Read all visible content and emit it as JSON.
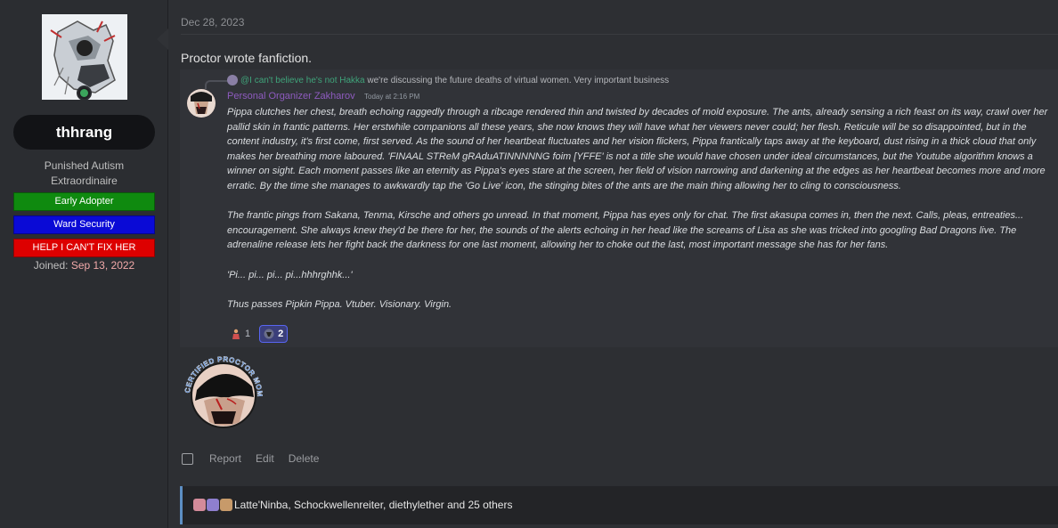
{
  "user": {
    "username": "thhrang",
    "title_line1": "Punished Autism",
    "title_line2": "Extraordinaire",
    "banners": [
      {
        "label": "Early Adopter",
        "color": "#0f8a0f"
      },
      {
        "label": "Ward Security",
        "color": "#0a0ad6"
      },
      {
        "label": "HELP I CAN'T FIX HER",
        "color": "#dd0000"
      }
    ],
    "joined_label": "Joined:",
    "joined_date": "Sep 13, 2022"
  },
  "post": {
    "date": "Dec 28, 2023",
    "text": "Proctor wrote fanfiction."
  },
  "embed": {
    "reply_mention": "@I can't believe he's not Hakka",
    "reply_text": "we're discussing the future deaths of virtual women. Very important business",
    "author": "Personal Organizer Zakharov",
    "time": "Today at 2:16 PM",
    "paragraphs": [
      "Pippa clutches her chest, breath echoing raggedly through a ribcage rendered thin and twisted by decades of mold exposure. The ants, already sensing a rich feast on its way, crawl over her pallid skin in frantic patterns. Her erstwhile companions all these years, she now knows they will have what her viewers never could; her flesh. Reticule will be so disappointed, but in the content industry, it's first come, first served. As the sound of her heartbeat fluctuates and her vision flickers, Pippa frantically taps away at the keyboard, dust rising in a thick cloud that only makes her breathing more laboured. 'FINAAL STReM gRAduATINNNNNG foim [YFFE' is not a title she would have chosen under ideal circumstances, but the Youtube algorithm knows a winner on sight. Each moment passes like an eternity as Pippa's eyes stare at the screen, her field of vision narrowing and darkening at the edges as her heartbeat becomes more and more erratic. By the time she manages to awkwardly tap the 'Go Live' icon, the stinging bites of the ants are the main thing allowing her to cling to consciousness.",
      "The frantic pings from Sakana, Tenma, Kirsche and others go unread. In that moment, Pippa has eyes only for chat. The first akasupa comes in, then the next. Calls, pleas, entreaties... encouragement. She always knew they'd be there for her, the sounds of the alerts echoing in her head like the screams of Lisa as she was tricked into googling Bad Dragons live. The adrenaline release lets her fight back the darkness for one last moment, allowing her to choke out the last, most important message she has for her fans.",
      "'Pi... pi... pi... pi...hhhrghhk...'",
      "Thus passes Pipkin Pippa. Vtuber. Visionary. Virgin."
    ],
    "reactions": [
      {
        "icon": "person-emoji-icon",
        "count": "1"
      },
      {
        "icon": "custom-emoji-icon",
        "count": "2"
      }
    ]
  },
  "badge_image": {
    "text": "CERTIFIED PROCTOR MOMENT"
  },
  "actions": {
    "report": "Report",
    "edit": "Edit",
    "delete": "Delete"
  },
  "likes": {
    "text": "Latte'Ninba, Schockwellenreiter, diethylether and 25 others"
  }
}
